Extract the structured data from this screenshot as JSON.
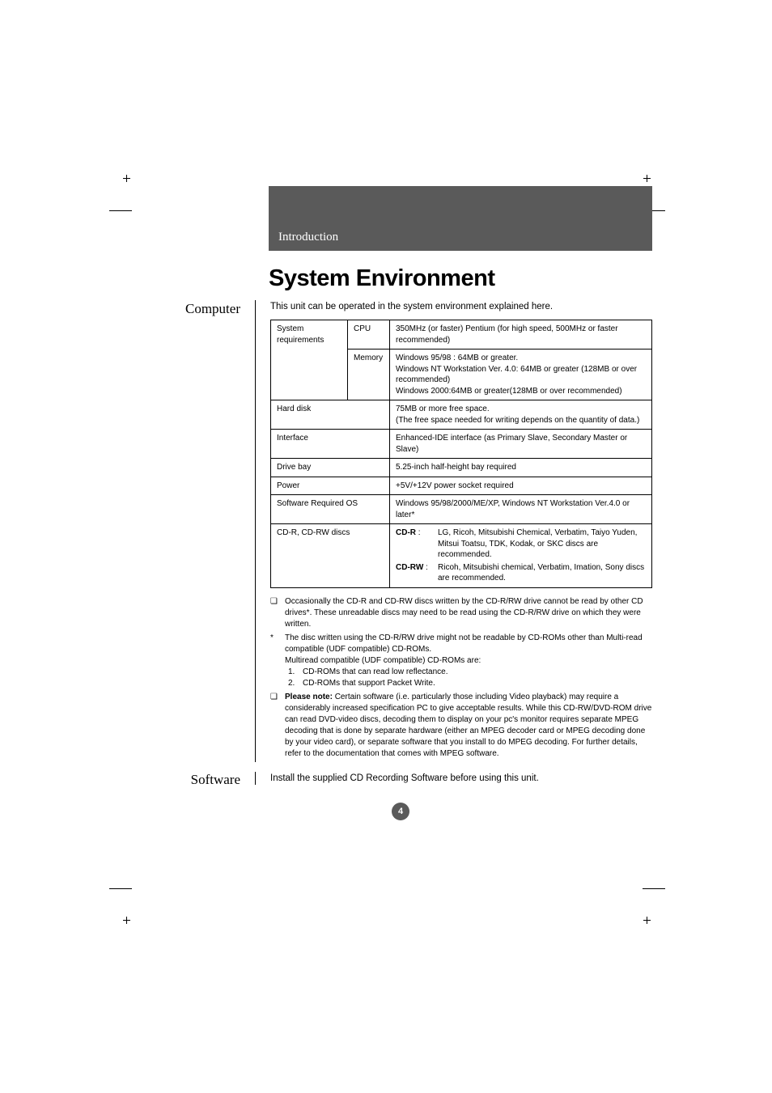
{
  "header": {
    "label": "Introduction"
  },
  "page_title": "System Environment",
  "sections": {
    "computer": {
      "label": "Computer",
      "intro": "This unit can be operated in the system environment explained here.",
      "table": {
        "rows": [
          {
            "c0": "System requirements",
            "c1": "CPU",
            "c2": "350MHz (or faster) Pentium (for high speed, 500MHz or faster recommended)",
            "rs0": 2
          },
          {
            "c1": "Memory",
            "c2": "Windows 95/98 : 64MB or greater.\nWindows NT Workstation Ver. 4.0: 64MB or greater (128MB or over recommended)\nWindows 2000:64MB or greater(128MB or over recommended)"
          },
          {
            "c0": "Hard disk",
            "cs0": 2,
            "c2": "75MB or more free space.\n(The free space needed for writing depends on the quantity of data.)"
          },
          {
            "c0": "Interface",
            "cs0": 2,
            "c2": "Enhanced-IDE interface (as Primary Slave, Secondary Master or Slave)"
          },
          {
            "c0": "Drive bay",
            "cs0": 2,
            "c2": "5.25-inch half-height bay required"
          },
          {
            "c0": "Power",
            "cs0": 2,
            "c2": "+5V/+12V power socket required"
          },
          {
            "c0": "Software Required OS",
            "cs0": 2,
            "c2": "Windows 95/98/2000/ME/XP, Windows NT Workstation Ver.4.0 or later*"
          },
          {
            "c0": "CD-R, CD-RW discs",
            "cs0": 2,
            "c2_html": true,
            "c2_cdr_label": "CD-R",
            "c2_cdr_text": "LG, Ricoh, Mitsubishi Chemical, Verbatim, Taiyo Yuden, Mitsui Toatsu, TDK, Kodak, or SKC discs are recommended.",
            "c2_cdrw_label": "CD-RW",
            "c2_cdrw_text": "Ricoh, Mitsubishi chemical, Verbatim, Imation, Sony discs are recommended."
          }
        ]
      },
      "notes": {
        "n1": "Occasionally the CD-R and CD-RW discs written by the CD-R/RW drive cannot be read by other CD drives*. These unreadable discs may need to be read using the CD-R/RW drive on which they were written.",
        "n2_line1": "The disc written using the CD-R/RW drive might not be readable by CD-ROMs other than Multi-read compatible (UDF compatible) CD-ROMs.",
        "n2_line2": "Multiread compatible (UDF compatible) CD-ROMs are:",
        "n2_s1": "CD-ROMs that can read low reflectance.",
        "n2_s2": "CD-ROMs that support Packet Write.",
        "n3_label": "Please note:",
        "n3_text": " Certain software (i.e. particularly those including Video playback) may require a considerably increased specification PC to give acceptable results. While this CD-RW/DVD-ROM drive can read DVD-video discs, decoding them to display on your pc's monitor requires separate MPEG decoding that is done by separate hardware (either an MPEG decoder card or MPEG decoding done by your video card), or separate software that you install to do MPEG decoding. For further details, refer to the documentation that comes with MPEG software."
      }
    },
    "software": {
      "label": "Software",
      "text": "Install the supplied CD Recording Software before using this unit."
    }
  },
  "page_number": "4"
}
